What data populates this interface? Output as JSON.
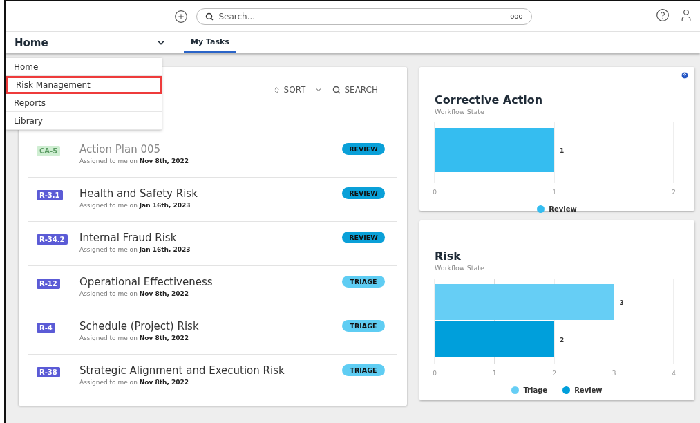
{
  "top_bar": {
    "search": {
      "placeholder": "Search...",
      "options": "ooo"
    }
  },
  "nav": {
    "title": "Home",
    "tabs": [
      {
        "label": "My Tasks",
        "selected": true
      }
    ]
  },
  "menu": {
    "items": [
      {
        "label": "Home",
        "highlighted": false
      },
      {
        "label": "Risk Management",
        "highlighted": true
      },
      {
        "label": "Reports",
        "highlighted": false
      },
      {
        "label": "Library",
        "highlighted": false
      }
    ]
  },
  "tasks": {
    "sort": "SORT",
    "search": "SEARCH",
    "rows": [
      {
        "id": "CA-5",
        "kind": "corrective",
        "title": "Action Plan 005",
        "assigned": "Assigned to me on",
        "date": "Nov 8th, 2022",
        "state": "REVIEW",
        "color": "#0aa0d8"
      },
      {
        "id": "R-3.1",
        "kind": "risk",
        "title": "Health and Safety Risk",
        "assigned": "Assigned to me on",
        "date": "Jan 16th, 2023",
        "state": "REVIEW",
        "color": "#0aa0d8"
      },
      {
        "id": "R-34.2",
        "kind": "risk",
        "title": "Internal Fraud Risk",
        "assigned": "Assigned to me on",
        "date": "Jan 16th, 2023",
        "state": "REVIEW",
        "color": "#0aa0d8"
      },
      {
        "id": "R-12",
        "kind": "risk",
        "title": "Operational Effectiveness",
        "assigned": "Assigned to me on",
        "date": "Nov 8th, 2022",
        "state": "TRIAGE",
        "color": "#5fcdf3"
      },
      {
        "id": "R-4",
        "kind": "risk",
        "title": "Schedule (Project) Risk",
        "assigned": "Assigned to me on",
        "date": "Nov 8th, 2022",
        "state": "TRIAGE",
        "color": "#5fcdf3"
      },
      {
        "id": "R-38",
        "kind": "risk",
        "title": "Strategic Alignment and Execution Risk",
        "assigned": "Assigned to me on",
        "date": "Nov 8th, 2022",
        "state": "TRIAGE",
        "color": "#5fcdf3"
      }
    ]
  },
  "widgets": [
    {
      "title": "Corrective Action",
      "subtitle": "Workflow State",
      "help": true,
      "chart_data": {
        "type": "bar",
        "orientation": "horizontal",
        "series": [
          {
            "name": "Review",
            "color": "#35bdf0",
            "values": [
              1
            ]
          }
        ],
        "xlim": [
          0,
          2
        ],
        "xticks": [
          0,
          1,
          2
        ],
        "grid": true,
        "data_labels": true
      }
    },
    {
      "title": "Risk",
      "subtitle": "Workflow State",
      "chart_data": {
        "type": "bar",
        "orientation": "horizontal",
        "series": [
          {
            "name": "Triage",
            "color": "#66cef5",
            "values": [
              3
            ]
          },
          {
            "name": "Review",
            "color": "#009fdb",
            "values": [
              2
            ]
          }
        ],
        "xlim": [
          0,
          4
        ],
        "xticks": [
          0,
          1,
          2,
          3,
          4
        ],
        "grid": true,
        "data_labels": true
      }
    }
  ]
}
